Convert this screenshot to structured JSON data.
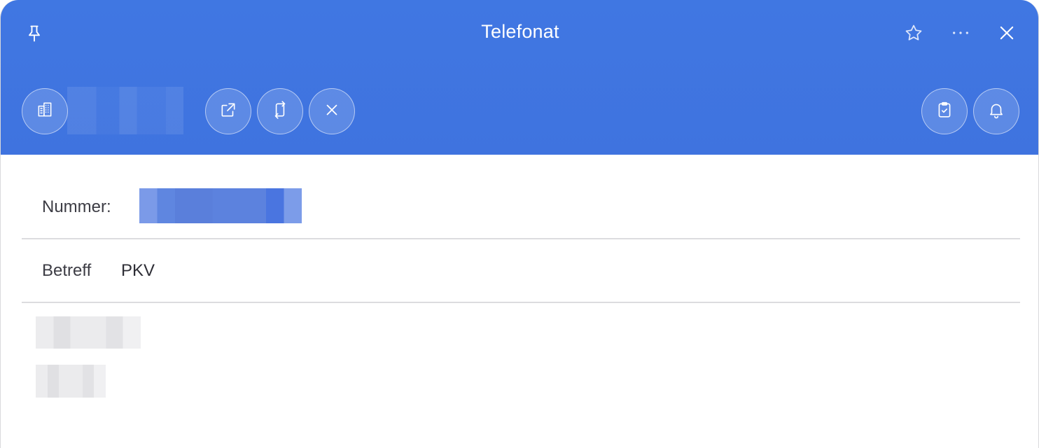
{
  "window": {
    "title": "Telefonat"
  },
  "header_icons": {
    "pin": "pin-icon",
    "favorite": "star-icon",
    "more": "more-icon",
    "close": "close-icon"
  },
  "toolbar": {
    "left_buttons": [
      "building-icon",
      "open-external-icon",
      "swap-icon",
      "cancel-icon"
    ],
    "right_buttons": [
      "clipboard-check-icon",
      "bell-icon"
    ]
  },
  "fields": {
    "number_label": "Nummer:",
    "subject_label": "Betreff",
    "subject_value": "PKV"
  },
  "colors": {
    "header_bg": "#4077e2",
    "header_text": "#ffffff",
    "divider": "#dcdcdf"
  }
}
